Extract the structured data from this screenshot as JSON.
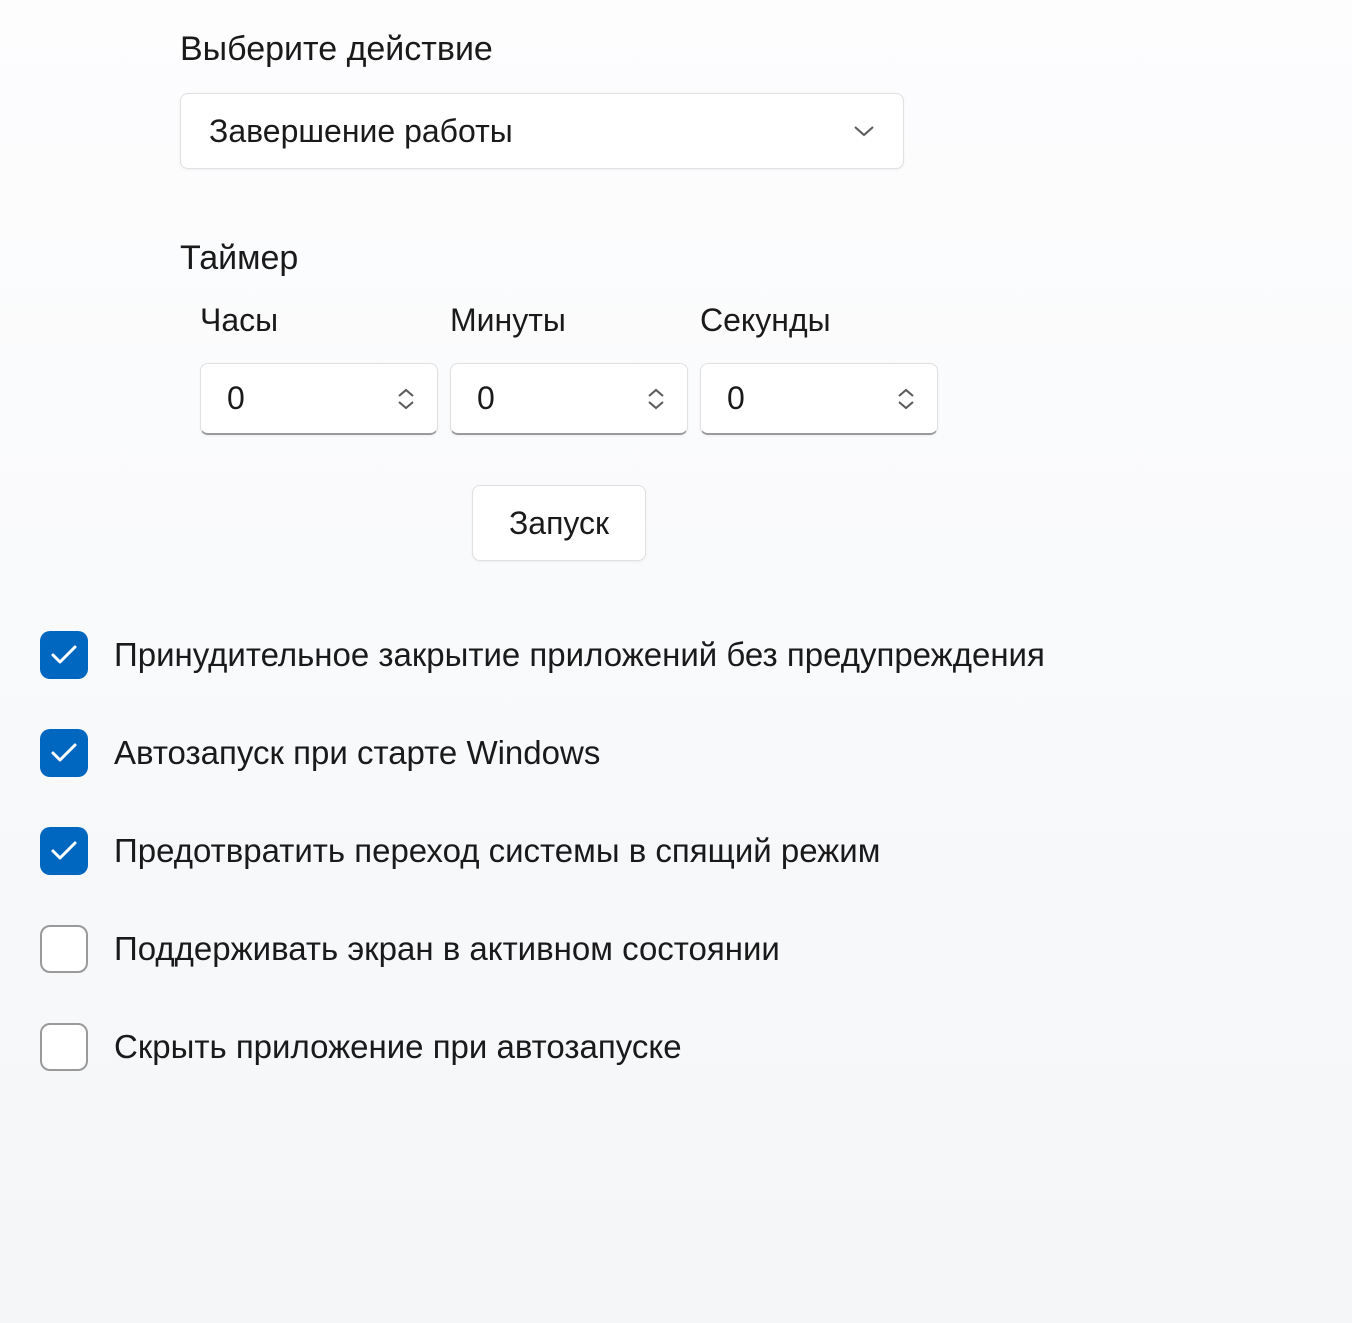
{
  "action": {
    "label": "Выберите действие",
    "selected": "Завершение работы"
  },
  "timer": {
    "label": "Таймер",
    "hours": {
      "label": "Часы",
      "value": "0"
    },
    "minutes": {
      "label": "Минуты",
      "value": "0"
    },
    "seconds": {
      "label": "Секунды",
      "value": "0"
    }
  },
  "start_button": "Запуск",
  "options": {
    "force_close": {
      "label": "Принудительное закрытие приложений без предупреждения",
      "checked": true
    },
    "autostart": {
      "label": "Автозапуск при старте Windows",
      "checked": true
    },
    "prevent_sleep": {
      "label": "Предотвратить переход системы в спящий режим",
      "checked": true
    },
    "keep_screen_active": {
      "label": "Поддерживать экран в активном состоянии",
      "checked": false
    },
    "hide_on_autostart": {
      "label": "Скрыть приложение при автозапуске",
      "checked": false
    }
  }
}
